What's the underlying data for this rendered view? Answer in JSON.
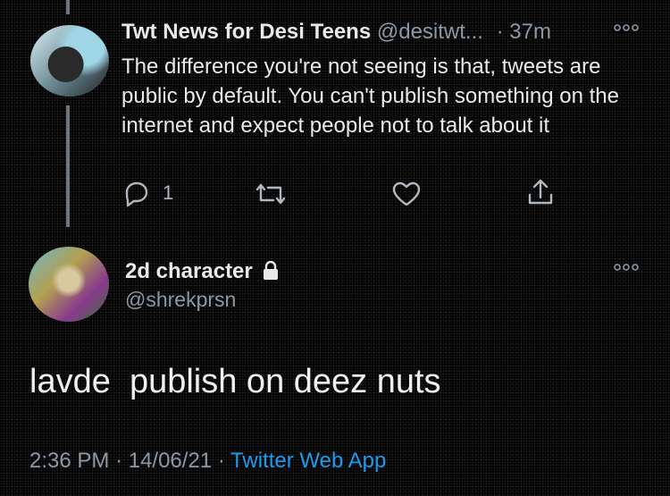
{
  "parent_tweet": {
    "display_name": "Twt News for Desi Teens",
    "handle": "@desitwt...",
    "time": "· 37m",
    "text": "The difference you're not seeing is that, tweets are public by default. You can't publish something on the internet and expect people not to talk about it",
    "reply_count": "1",
    "icons": [
      "reply-icon",
      "retweet-icon",
      "like-icon",
      "share-icon",
      "more-icon"
    ]
  },
  "reply_tweet": {
    "display_name": "2d character",
    "handle": "@shrekprsn",
    "text": "lavde  publish on deez nuts",
    "icons": [
      "lock-icon",
      "more-icon"
    ]
  },
  "meta": {
    "time": "2:36 PM",
    "date": "· 14/06/21 ·",
    "app": "Twitter Web App"
  },
  "colors": {
    "background": "#000000",
    "text": "#e7e9ea",
    "secondary": "#8b98a5",
    "accent": "#1d9bf0"
  }
}
